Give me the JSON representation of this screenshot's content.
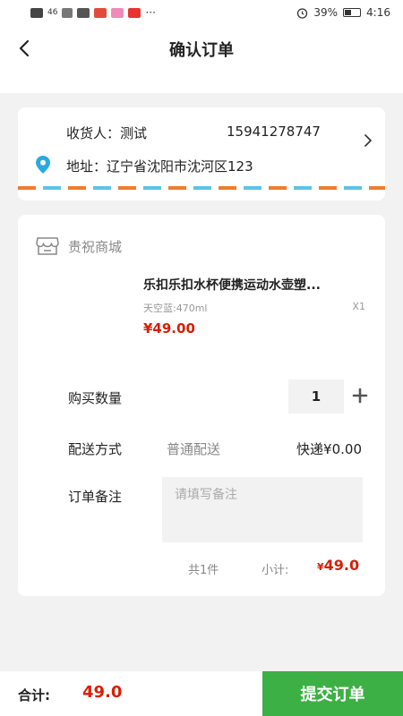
{
  "status_bar": {
    "signal": "46",
    "battery_percent": "39%",
    "time": "4:16",
    "more": "···"
  },
  "nav": {
    "title": "确认订单"
  },
  "address": {
    "recipient_label": "收货人：",
    "recipient_name": "测试",
    "phone": "15941278747",
    "address_label": "地址：",
    "address_value": "辽宁省沈阳市沈河区123"
  },
  "order": {
    "shop_name": "贵祝商城",
    "product": {
      "title": "乐扣乐扣水杯便携运动水壶塑...",
      "spec": "天空蓝:470ml",
      "quantity": "X1",
      "price": "¥49.00"
    },
    "quantity_label": "购买数量",
    "quantity_value": "1",
    "delivery_label": "配送方式",
    "delivery_method": "普通配送",
    "delivery_fee": "快递¥0.00",
    "note_label": "订单备注",
    "note_placeholder": "请填写备注",
    "total_count": "共1件",
    "subtotal_label": "小计:",
    "subtotal_currency": "¥",
    "subtotal_value": "49.0"
  },
  "footer": {
    "total_label": "合计:",
    "total_value": "49.0",
    "submit_label": "提交订单"
  },
  "colors": {
    "accent_green": "#3cb044",
    "price_red": "#d81e06",
    "location_pin": "#2aa9e0"
  },
  "icons": {
    "back": "chevron-left-icon",
    "address_arrow": "chevron-right-icon",
    "location": "location-pin-icon",
    "shop": "store-icon",
    "plus": "plus-icon"
  }
}
